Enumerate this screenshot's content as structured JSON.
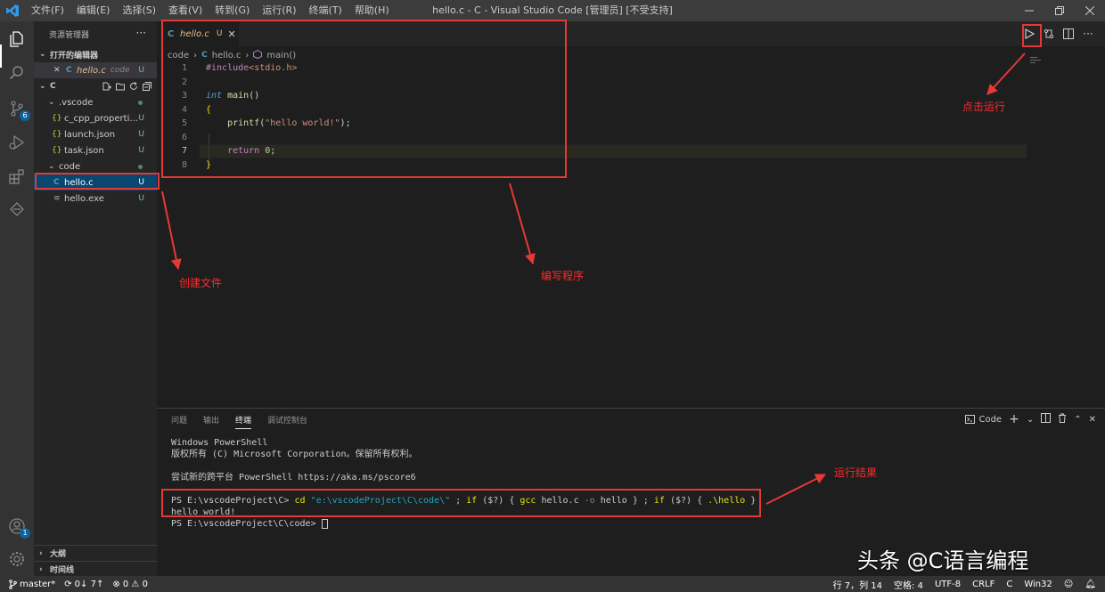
{
  "titlebar": {
    "menu": [
      "文件(F)",
      "编辑(E)",
      "选择(S)",
      "查看(V)",
      "转到(G)",
      "运行(R)",
      "终端(T)",
      "帮助(H)"
    ],
    "title": "hello.c - C - Visual Studio Code [管理员] [不受支持]"
  },
  "activitybar": {
    "source_control_badge": "6",
    "accounts_badge": "1"
  },
  "sidebar": {
    "title": "资源管理器",
    "more": "···",
    "open_editors_label": "打开的编辑器",
    "open_editor": {
      "close": "✕",
      "icon": "C",
      "name": "hello.c",
      "folder": "code",
      "status": "U"
    },
    "workspace_label": "C",
    "tree": [
      {
        "depth": 1,
        "type": "folder",
        "name": ".vscode",
        "status": "dot"
      },
      {
        "depth": 2,
        "type": "json",
        "icon": "{}",
        "name": "c_cpp_properti...",
        "status": "U"
      },
      {
        "depth": 2,
        "type": "json",
        "icon": "{}",
        "name": "launch.json",
        "status": "U"
      },
      {
        "depth": 2,
        "type": "json",
        "icon": "{}",
        "name": "task.json",
        "status": "U"
      },
      {
        "depth": 1,
        "type": "folder",
        "name": "code",
        "status": "dot"
      },
      {
        "depth": 2,
        "type": "c",
        "icon": "C",
        "name": "hello.c",
        "status": "U"
      },
      {
        "depth": 2,
        "type": "exe",
        "icon": "≡",
        "name": "hello.exe",
        "status": "U"
      }
    ],
    "outline_label": "大纲",
    "timeline_label": "时间线"
  },
  "editor": {
    "tab": {
      "icon": "C",
      "name": "hello.c",
      "status": "U",
      "close": "✕"
    },
    "breadcrumb": [
      "code",
      "C",
      "hello.c",
      "main()"
    ],
    "lines": [
      {
        "n": "1",
        "html_tokens": [
          [
            "pp",
            "#include"
          ],
          [
            "str",
            "<stdio.h>"
          ]
        ]
      },
      {
        "n": "2",
        "html_tokens": []
      },
      {
        "n": "3",
        "html_tokens": [
          [
            "type",
            "int"
          ],
          [
            "plain",
            " "
          ],
          [
            "fn",
            "main"
          ],
          [
            "plain",
            "()"
          ]
        ]
      },
      {
        "n": "4",
        "html_tokens": [
          [
            "brace",
            "{"
          ]
        ]
      },
      {
        "n": "5",
        "html_tokens": [
          [
            "plain",
            "    "
          ],
          [
            "fn",
            "printf"
          ],
          [
            "plain",
            "("
          ],
          [
            "str",
            "\"hello world!\""
          ],
          [
            "plain",
            ");"
          ]
        ]
      },
      {
        "n": "6",
        "html_tokens": []
      },
      {
        "n": "7",
        "html_tokens": [
          [
            "plain",
            "    "
          ],
          [
            "ctrl",
            "return"
          ],
          [
            "plain",
            " "
          ],
          [
            "num",
            "0"
          ],
          [
            "plain",
            ";"
          ]
        ]
      },
      {
        "n": "8",
        "html_tokens": [
          [
            "brace",
            "}"
          ]
        ]
      }
    ],
    "active_line": "7"
  },
  "panel": {
    "tabs": [
      "问题",
      "输出",
      "终端",
      "调试控制台"
    ],
    "active_tab": "终端",
    "terminal_name": "Code",
    "terminal": {
      "line1": "Windows PowerShell",
      "line2": "版权所有 (C) Microsoft Corporation。保留所有权利。",
      "line3": "尝试新的跨平台 PowerShell https://aka.ms/pscore6",
      "prompt1": "PS E:\\vscodeProject\\C> ",
      "cmd_cd": "cd",
      "cmd_path": " \"e:\\vscodeProject\\C\\code\\\"",
      "cmd_rest1": " ; ",
      "cmd_if1": "if",
      "cmd_q1": " ($?) { ",
      "cmd_gcc": "gcc",
      "cmd_gcc_args": " hello.c ",
      "cmd_o": "-o",
      "cmd_hello": " hello } ; ",
      "cmd_if2": "if",
      "cmd_q2": " ($?) { ",
      "cmd_run": ".\\hello",
      "cmd_end": " }",
      "output": "hello world!",
      "prompt2": "PS E:\\vscodeProject\\C\\code> "
    }
  },
  "statusbar": {
    "branch": "master*",
    "sync": "0↓ 7↑",
    "problems": "⊗ 0 ⚠ 0",
    "position": "行 7，列 14",
    "spaces": "空格: 4",
    "encoding": "UTF-8",
    "eol": "CRLF",
    "language": "C",
    "platform": "Win32"
  },
  "annotations": {
    "run_hint": "点击运行",
    "create_file": "创建文件",
    "write_program": "编写程序",
    "run_result": "运行结果"
  },
  "watermark": "头条 @C语言编程",
  "colors": {
    "accent": "#0e639c",
    "annotation_red": "#e53935",
    "untracked": "#73c991"
  }
}
